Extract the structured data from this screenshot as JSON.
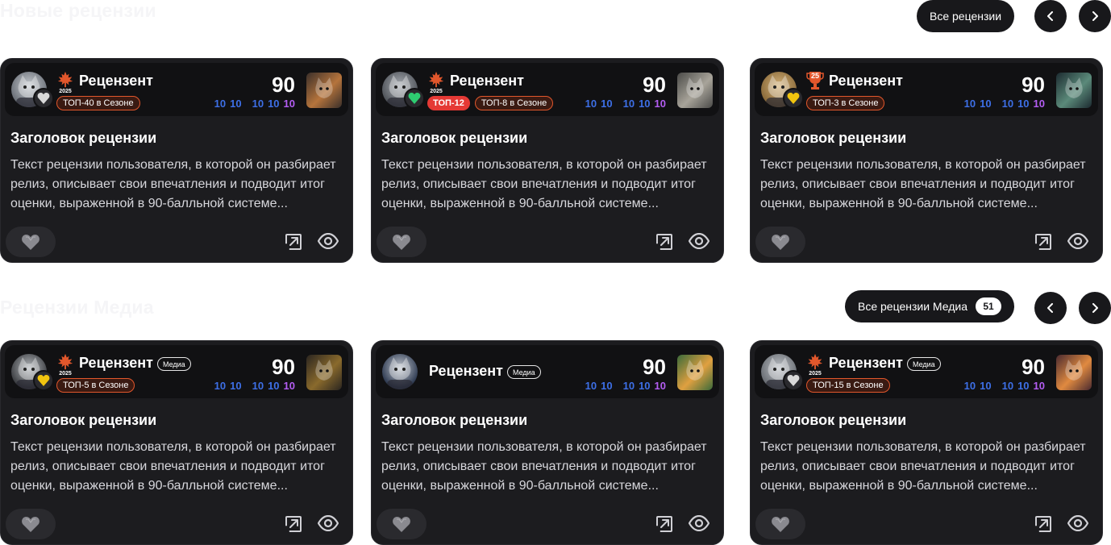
{
  "sections": [
    {
      "title": "Новые рецензии",
      "all_label": "Все рецензии",
      "count": null,
      "prev_icon": "chevron-left-icon",
      "next_icon": "chevron-right-icon",
      "cards": [
        {
          "username": "Рецензент",
          "season_year": "2025",
          "season_icon": "maple-leaf-icon",
          "media": false,
          "badge_color": "#d9d9d9",
          "tags": [
            {
              "label": "ТОП-40 в Сезоне",
              "style": "outline"
            }
          ],
          "score": "90",
          "subscores": [
            "10",
            "10",
            "10",
            "10",
            "10"
          ],
          "title": "Заголовок рецензии",
          "text": "Текст рецензии пользователя, в которой он разбирает релиз, описывает свои впечатления и подводит итог оценки, выраженной в 90-балльной системе..."
        },
        {
          "username": "Рецензент",
          "season_year": "2025",
          "season_icon": "maple-leaf-icon",
          "media": false,
          "badge_color": "#2ecc71",
          "tags": [
            {
              "label": "ТОП-12",
              "style": "red"
            },
            {
              "label": "ТОП-8 в Сезоне",
              "style": "outline"
            }
          ],
          "score": "90",
          "subscores": [
            "10",
            "10",
            "10",
            "10",
            "10"
          ],
          "title": "Заголовок рецензии",
          "text": "Текст рецензии пользователя, в которой он разбирает релиз, описывает свои впечатления и подводит итог оценки, выраженной в 90-балльной системе..."
        },
        {
          "username": "Рецензент",
          "season_year": "",
          "season_icon": "trophy-icon",
          "trophy_label": "25",
          "media": false,
          "badge_color": "#f1c40f",
          "tags": [
            {
              "label": "ТОП-3 в Сезоне",
              "style": "outline"
            }
          ],
          "score": "90",
          "subscores": [
            "10",
            "10",
            "10",
            "10",
            "10"
          ],
          "title": "Заголовок рецензии",
          "text": "Текст рецензии пользователя, в которой он разбирает релиз, описывает свои впечатления и подводит итог оценки, выраженной в 90-балльной системе..."
        }
      ]
    },
    {
      "title": "Рецензии Медиа",
      "all_label": "Все рецензии Медиа",
      "count": "51",
      "prev_icon": "chevron-left-icon",
      "next_icon": "chevron-right-icon",
      "cards": [
        {
          "username": "Рецензент",
          "season_year": "2025",
          "season_icon": "maple-leaf-icon",
          "media": true,
          "media_label": "Медиа",
          "badge_color": "#f1c40f",
          "tags": [
            {
              "label": "ТОП-5 в Сезоне",
              "style": "outline"
            }
          ],
          "score": "90",
          "subscores": [
            "10",
            "10",
            "10",
            "10",
            "10"
          ],
          "title": "Заголовок рецензии",
          "text": "Текст рецензии пользователя, в которой он разбирает релиз, описывает свои впечатления и подводит итог оценки, выраженной в 90-балльной системе..."
        },
        {
          "username": "Рецензент",
          "season_year": "",
          "season_icon": "",
          "media": true,
          "media_label": "Медиа",
          "badge_color": "",
          "tags": [],
          "score": "90",
          "subscores": [
            "10",
            "10",
            "10",
            "10",
            "10"
          ],
          "title": "Заголовок рецензии",
          "text": "Текст рецензии пользователя, в которой он разбирает релиз, описывает свои впечатления и подводит итог оценки, выраженной в 90-балльной системе..."
        },
        {
          "username": "Рецензент",
          "season_year": "2025",
          "season_icon": "maple-leaf-icon",
          "media": true,
          "media_label": "Медиа",
          "badge_color": "#d9d9d9",
          "tags": [
            {
              "label": "ТОП-15 в Сезоне",
              "style": "outline"
            }
          ],
          "score": "90",
          "subscores": [
            "10",
            "10",
            "10",
            "10",
            "10"
          ],
          "title": "Заголовок рецензии",
          "text": "Текст рецензии пользователя, в которой он разбирает релиз, описывает свои впечатления и подводит итог оценки, выраженной в 90-балльной системе..."
        }
      ]
    }
  ],
  "colors": {
    "card_bg": "#1c1c1f",
    "subscore_blue": "#3d6fe6",
    "subscore_purple": "#b35df2",
    "tag_accent": "#e2572c",
    "tag_red": "#e53935"
  },
  "icons": {
    "like": "heart-icon",
    "share": "share-arrow-icon",
    "views": "eye-icon"
  }
}
